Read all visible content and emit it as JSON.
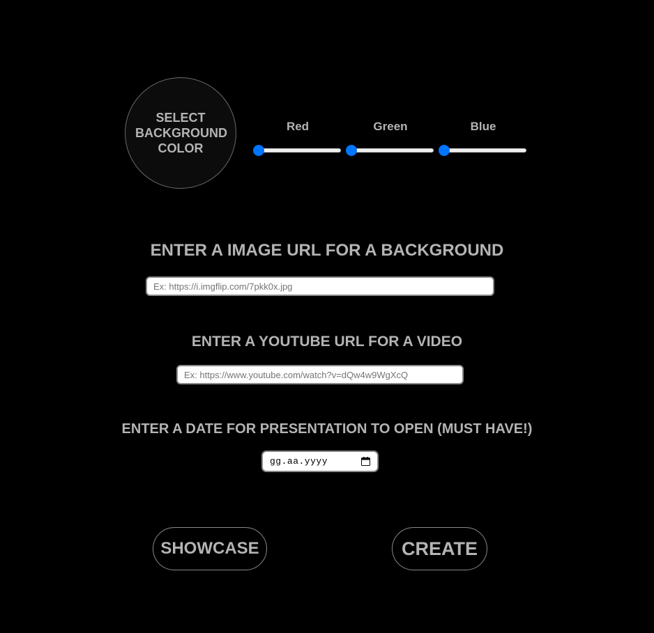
{
  "color_picker": {
    "circle_label": "SELECT\nBACKGROUND\nCOLOR",
    "circle_color": "#0c0c0c",
    "sliders": [
      {
        "label": "Red",
        "value": 0,
        "min": 0,
        "max": 255
      },
      {
        "label": "Green",
        "value": 0,
        "min": 0,
        "max": 255
      },
      {
        "label": "Blue",
        "value": 0,
        "min": 0,
        "max": 255
      }
    ],
    "slider_accent": "#0075ff"
  },
  "image_section": {
    "heading": "ENTER A IMAGE URL FOR A BACKGROUND",
    "value": "",
    "placeholder": "Ex: https://i.imgflip.com/7pkk0x.jpg"
  },
  "video_section": {
    "heading": "ENTER A YOUTUBE URL FOR A VIDEO",
    "value": "",
    "placeholder": "Ex: https://www.youtube.com/watch?v=dQw4w9WgXcQ"
  },
  "date_section": {
    "heading": "ENTER A DATE FOR PRESENTATION TO OPEN (MUST HAVE!)",
    "display": "gg.aa.yyyy",
    "icon": "calendar-icon"
  },
  "buttons": {
    "showcase": "SHOWCASE",
    "create": "CREATE"
  },
  "colors": {
    "background": "#000000",
    "text": "#b4b4b4",
    "border": "#8a8a8a"
  }
}
